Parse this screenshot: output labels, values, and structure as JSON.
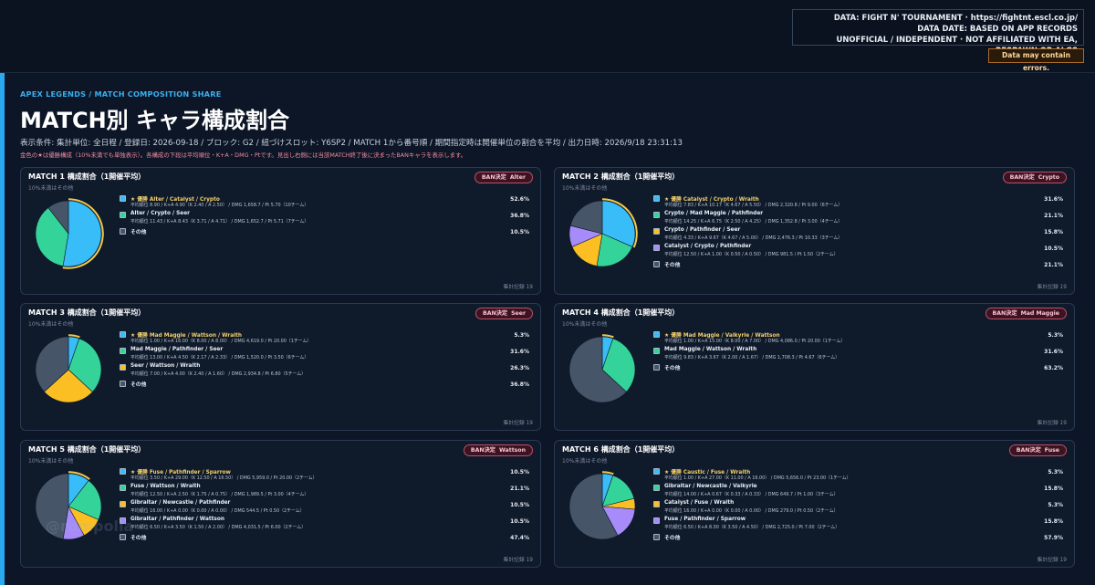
{
  "header": {
    "data_line1": "DATA: FIGHT N' TOURNAMENT · https://fightnt.escl.co.jp/",
    "data_line2": "DATA DATE: BASED ON APP RECORDS",
    "data_line3": "UNOFFICIAL / INDEPENDENT · NOT AFFILIATED WITH EA, RESPAWN OR ALGS",
    "error_notice": "Data may contain errors."
  },
  "page": {
    "kicker": "APEX LEGENDS / MATCH COMPOSITION SHARE",
    "title": "MATCH別 キャラ構成割合",
    "conditions": "表示条件: 集計単位: 全日程 / 登録日: 2026-09-18 / ブロック: G2 / 紐づけスロット: Y6SP2 / MATCH 1から番号順 / 期間指定時は開催単位の割合を平均 / 出力日時: 2026/9/18 23:31:13",
    "note": "金色の★は優勝構成（10%未満でも単独表示）。各構成の下段は平均順位・K+A・DMG・Ptです。見出し右側には当該MATCH終了後に決まったBANキャラを表示します。",
    "watermark": "@rdmpolia"
  },
  "colors": {
    "blue": "#38bdf8",
    "green": "#34d399",
    "yellow": "#fbbf24",
    "purple": "#a78bfa",
    "other": "#475569",
    "gold": "#f2c94c"
  },
  "chart_data": [
    {
      "type": "pie",
      "title": "MATCH 1 構成割合（1開催平均）",
      "subtitle": "10%未満はその他",
      "ban_label": "BAN決定",
      "ban_value": "Alter",
      "footer": "集計記録 19",
      "slices": [
        {
          "name": "Alter / Catalyst / Crypto",
          "winner": true,
          "winner_prefix": "★ 優勝",
          "value": 52.6,
          "pct_label": "52.6%",
          "color": "blue",
          "stats": "平均順位 8.90 / K+A 4.90（K 2.40 / A 2.50） / DMG 1,658.7 / Pt 5.70（10チーム）"
        },
        {
          "name": "Alter / Crypto / Seer",
          "winner": false,
          "value": 36.8,
          "pct_label": "36.8%",
          "color": "green",
          "stats": "平均順位 11.43 / K+A 8.43（K 3.71 / A 4.71） / DMG 1,652.7 / Pt 5.71（7チーム）"
        },
        {
          "name": "その他",
          "winner": false,
          "value": 10.5,
          "pct_label": "10.5%",
          "color": "other",
          "stats": ""
        }
      ]
    },
    {
      "type": "pie",
      "title": "MATCH 2 構成割合（1開催平均）",
      "subtitle": "10%未満はその他",
      "ban_label": "BAN決定",
      "ban_value": "Crypto",
      "footer": "集計記録 19",
      "slices": [
        {
          "name": "Catalyst / Crypto / Wraith",
          "winner": true,
          "winner_prefix": "★ 優勝",
          "value": 31.6,
          "pct_label": "31.6%",
          "color": "blue",
          "stats": "平均順位 7.83 / K+A 10.17（K 4.67 / A 5.50） / DMG 2,320.8 / Pt 9.00（6チーム）"
        },
        {
          "name": "Crypto / Mad Maggie / Pathfinder",
          "winner": false,
          "value": 21.1,
          "pct_label": "21.1%",
          "color": "green",
          "stats": "平均順位 14.25 / K+A 6.75（K 2.50 / A 4.25） / DMG 1,352.8 / Pt 3.00（4チーム）"
        },
        {
          "name": "Crypto / Pathfinder / Seer",
          "winner": false,
          "value": 15.8,
          "pct_label": "15.8%",
          "color": "yellow",
          "stats": "平均順位 4.33 / K+A 9.67（K 4.67 / A 5.00） / DMG 2,476.3 / Pt 10.33（3チーム）"
        },
        {
          "name": "Catalyst / Crypto / Pathfinder",
          "winner": false,
          "value": 10.5,
          "pct_label": "10.5%",
          "color": "purple",
          "stats": "平均順位 12.50 / K+A 1.00（K 0.50 / A 0.50） / DMG 981.5 / Pt 1.50（2チーム）"
        },
        {
          "name": "その他",
          "winner": false,
          "value": 21.1,
          "pct_label": "21.1%",
          "color": "other",
          "stats": ""
        }
      ]
    },
    {
      "type": "pie",
      "title": "MATCH 3 構成割合（1開催平均）",
      "subtitle": "10%未満はその他",
      "ban_label": "BAN決定",
      "ban_value": "Seer",
      "footer": "集計記録 19",
      "slices": [
        {
          "name": "Mad Maggie / Wattson / Wraith",
          "winner": true,
          "winner_prefix": "★ 優勝",
          "value": 5.3,
          "pct_label": "5.3%",
          "color": "blue",
          "stats": "平均順位 1.00 / K+A 16.00（K 8.00 / A 8.00） / DMG 4,619.0 / Pt 20.00（1チーム）"
        },
        {
          "name": "Mad Maggie / Pathfinder / Seer",
          "winner": false,
          "value": 31.6,
          "pct_label": "31.6%",
          "color": "green",
          "stats": "平均順位 13.00 / K+A 4.50（K 2.17 / A 2.33） / DMG 1,520.0 / Pt 3.50（6チーム）"
        },
        {
          "name": "Seer / Wattson / Wraith",
          "winner": false,
          "value": 26.3,
          "pct_label": "26.3%",
          "color": "yellow",
          "stats": "平均順位 7.00 / K+A 4.00（K 2.40 / A 1.60） / DMG 2,934.8 / Pt 6.80（5チーム）"
        },
        {
          "name": "その他",
          "winner": false,
          "value": 36.8,
          "pct_label": "36.8%",
          "color": "other",
          "stats": ""
        }
      ]
    },
    {
      "type": "pie",
      "title": "MATCH 4 構成割合（1開催平均）",
      "subtitle": "10%未満はその他",
      "ban_label": "BAN決定",
      "ban_value": "Mad Maggie",
      "footer": "集計記録 19",
      "slices": [
        {
          "name": "Mad Maggie / Valkyrie / Wattson",
          "winner": true,
          "winner_prefix": "★ 優勝",
          "value": 5.3,
          "pct_label": "5.3%",
          "color": "blue",
          "stats": "平均順位 1.00 / K+A 15.00（K 8.00 / A 7.00） / DMG 4,086.0 / Pt 20.00（1チーム）"
        },
        {
          "name": "Mad Maggie / Wattson / Wraith",
          "winner": false,
          "value": 31.6,
          "pct_label": "31.6%",
          "color": "green",
          "stats": "平均順位 9.83 / K+A 3.67（K 2.00 / A 1.67） / DMG 1,708.3 / Pt 4.67（6チーム）"
        },
        {
          "name": "その他",
          "winner": false,
          "value": 63.2,
          "pct_label": "63.2%",
          "color": "other",
          "stats": ""
        }
      ]
    },
    {
      "type": "pie",
      "title": "MATCH 5 構成割合（1開催平均）",
      "subtitle": "10%未満はその他",
      "ban_label": "BAN決定",
      "ban_value": "Wattson",
      "footer": "集計記録 19",
      "slices": [
        {
          "name": "Fuse / Pathfinder / Sparrow",
          "winner": true,
          "winner_prefix": "★ 優勝",
          "value": 10.5,
          "pct_label": "10.5%",
          "color": "blue",
          "stats": "平均順位 3.50 / K+A 29.00（K 12.50 / A 16.50） / DMG 5,959.0 / Pt 20.00（2チーム）"
        },
        {
          "name": "Fuse / Wattson / Wraith",
          "winner": false,
          "value": 21.1,
          "pct_label": "21.1%",
          "color": "green",
          "stats": "平均順位 12.50 / K+A 2.50（K 1.75 / A 0.75） / DMG 1,989.5 / Pt 3.00（4チーム）"
        },
        {
          "name": "Gibraltar / Newcastle / Pathfinder",
          "winner": false,
          "value": 10.5,
          "pct_label": "10.5%",
          "color": "yellow",
          "stats": "平均順位 16.00 / K+A 0.00（K 0.00 / A 0.00） / DMG 544.5 / Pt 0.50（2チーム）"
        },
        {
          "name": "Gibraltar / Pathfinder / Wattson",
          "winner": false,
          "value": 10.5,
          "pct_label": "10.5%",
          "color": "purple",
          "stats": "平均順位 6.50 / K+A 3.50（K 1.50 / A 2.00） / DMG 4,031.5 / Pt 6.00（2チーム）"
        },
        {
          "name": "その他",
          "winner": false,
          "value": 47.4,
          "pct_label": "47.4%",
          "color": "other",
          "stats": ""
        }
      ]
    },
    {
      "type": "pie",
      "title": "MATCH 6 構成割合（1開催平均）",
      "subtitle": "10%未満はその他",
      "ban_label": "BAN決定",
      "ban_value": "Fuse",
      "footer": "集計記録 19",
      "slices": [
        {
          "name": "Caustic / Fuse / Wraith",
          "winner": true,
          "winner_prefix": "★ 優勝",
          "value": 5.3,
          "pct_label": "5.3%",
          "color": "blue",
          "stats": "平均順位 1.00 / K+A 27.00（K 11.00 / A 16.00） / DMG 5,656.0 / Pt 23.00（1チーム）"
        },
        {
          "name": "Gibraltar / Newcastle / Valkyrie",
          "winner": false,
          "value": 15.8,
          "pct_label": "15.8%",
          "color": "green",
          "stats": "平均順位 14.00 / K+A 0.67（K 0.33 / A 0.33） / DMG 649.7 / Pt 1.00（3チーム）"
        },
        {
          "name": "Catalyst / Fuse / Wraith",
          "winner": false,
          "value": 5.3,
          "pct_label": "5.3%",
          "color": "yellow",
          "stats": "平均順位 16.00 / K+A 0.00（K 0.00 / A 0.00） / DMG 279.0 / Pt 0.50（2チーム）"
        },
        {
          "name": "Fuse / Pathfinder / Sparrow",
          "winner": false,
          "value": 15.8,
          "pct_label": "15.8%",
          "color": "purple",
          "stats": "平均順位 6.50 / K+A 8.00（K 3.50 / A 4.50） / DMG 2,725.0 / Pt 7.00（2チーム）"
        },
        {
          "name": "その他",
          "winner": false,
          "value": 57.9,
          "pct_label": "57.9%",
          "color": "other",
          "stats": ""
        }
      ]
    }
  ]
}
